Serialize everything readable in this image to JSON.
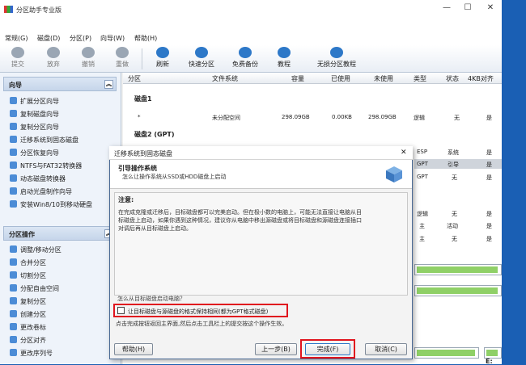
{
  "window": {
    "title": "分区助手专业版",
    "min": "—",
    "max": "☐",
    "close": "✕"
  },
  "menu": [
    "常规(G)",
    "磁盘(D)",
    "分区(P)",
    "向导(W)",
    "帮助(H)"
  ],
  "toolbar": [
    {
      "label": "提交",
      "icon": "commit-icon",
      "enabled": false
    },
    {
      "label": "放弃",
      "icon": "discard-icon",
      "enabled": false
    },
    {
      "label": "撤销",
      "icon": "undo-icon",
      "enabled": false
    },
    {
      "label": "重做",
      "icon": "redo-icon",
      "enabled": false
    },
    {
      "label": "刷新",
      "icon": "refresh-icon",
      "enabled": true
    },
    {
      "label": "快速分区",
      "icon": "quick-partition-icon",
      "enabled": true
    },
    {
      "label": "免费备份",
      "icon": "free-backup-icon",
      "enabled": true
    },
    {
      "label": "教程",
      "icon": "tutorial-icon",
      "enabled": true
    },
    {
      "label": "无损分区教程",
      "icon": "lossless-tutorial-icon",
      "enabled": true
    }
  ],
  "wizard_panel": {
    "title": "向导",
    "collapse": "︽",
    "items": [
      "扩展分区向导",
      "复制磁盘向导",
      "复制分区向导",
      "迁移系统到固态磁盘",
      "分区恢复向导",
      "NTFS与FAT32转换器",
      "动态磁盘转换器",
      "启动光盘制作向导",
      "安装Win8/10到移动硬盘"
    ]
  },
  "partition_panel": {
    "title": "分区操作",
    "collapse": "︽",
    "items": [
      "调整/移动分区",
      "合并分区",
      "切割分区",
      "分配自由空间",
      "复制分区",
      "创建分区",
      "更改卷标",
      "分区对齐",
      "更改序列号"
    ]
  },
  "grid": {
    "headers": [
      "分区",
      "文件系统",
      "容量",
      "已使用",
      "未使用",
      "类型",
      "状态",
      "4KB对齐"
    ],
    "disk1_label": "磁盘1",
    "disk1_row": [
      "*",
      "未分配空间",
      "298.09GB",
      "0.00KB",
      "298.09GB",
      "逻辑",
      "无",
      "是"
    ],
    "disk2_label": "磁盘2 (GPT)",
    "right_rows": [
      [
        "ESP",
        "系统",
        "是"
      ],
      [
        "GPT",
        "引导",
        "是"
      ],
      [
        "GPT",
        "无",
        "是"
      ],
      [
        "逻辑",
        "无",
        "是"
      ],
      [
        "主",
        "活动",
        "是"
      ],
      [
        "主",
        "无",
        "是"
      ]
    ],
    "corner_label": "E:"
  },
  "dialog": {
    "title": "迁移系统到固态磁盘",
    "close": "✕",
    "heading": "引导操作系统",
    "subheading": "怎么让操作系统从SSD或HDD磁盘上启动",
    "note_title": "注意:",
    "note_lines": [
      "在完成克隆或迁移后，目标磁盘都可以完美启动。但在极小数的电脑上，可能无法直接让电脑从目",
      "标磁盘上启动，如果你遇到这种情况，建议你从电脑中移出源磁盘或将目标磁盘和源磁盘连接插口",
      "对调后再从目标磁盘上启动。"
    ],
    "question": "怎么从目标磁盘启动电脑？",
    "checkbox_label": "让目标磁盘与源磁盘的格式保持相同(都为GPT格式磁盘)",
    "hint": "点击完成按钮返回主界面,然后点击工具栏上的提交按这个操作生效。",
    "help_button": "帮助(H)",
    "prev_button": "上一步(B)",
    "finish_button": "完成(F)",
    "cancel_button": "取消(C)"
  },
  "colors": {
    "accent": "#2d78c8",
    "highlight": "#e0141e",
    "disk_fill": "#8fd067"
  }
}
